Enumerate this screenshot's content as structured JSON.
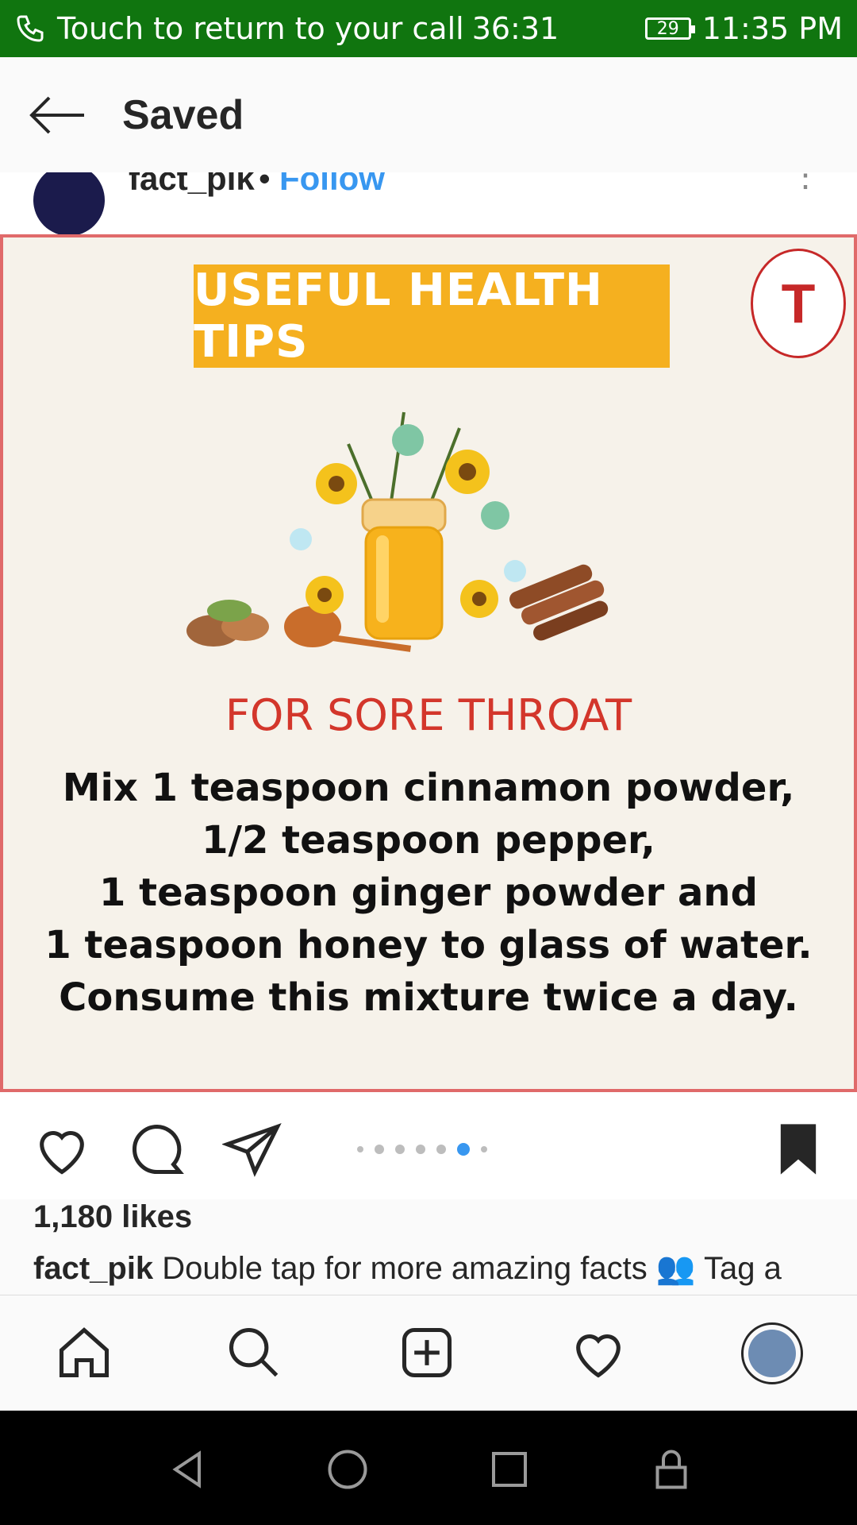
{
  "status_bar": {
    "call_text": "Touch to return to your call",
    "call_timer": "36:31",
    "battery": "29",
    "time": "11:35 PM"
  },
  "header": {
    "title": "Saved",
    "back_icon": "arrow-left-icon"
  },
  "post": {
    "username": "fact_pik",
    "separator": "•",
    "follow_label": "Follow",
    "more_icon": "more-vertical-icon",
    "image": {
      "banner": "USEFUL HEALTH TIPS",
      "logo_letter": "T",
      "subtitle": "FOR SORE THROAT",
      "lines": [
        "Mix 1 teaspoon cinnamon powder,",
        "1/2 teaspoon pepper,",
        "1 teaspoon ginger powder and",
        "1 teaspoon honey to glass of water.",
        "Consume this mixture twice a day."
      ]
    },
    "carousel": {
      "count": 7,
      "active_index": 5
    },
    "likes": "1,180 likes",
    "caption_user": "fact_pik",
    "caption_text": "Double tap for more amazing facts",
    "caption_tail": "Tag a"
  },
  "bottom_nav": [
    "home-icon",
    "search-icon",
    "add-icon",
    "heart-icon",
    "profile-avatar"
  ],
  "system_nav": [
    "back-triangle-icon",
    "home-circle-icon",
    "recents-square-icon",
    "lock-icon"
  ],
  "colors": {
    "status_bar": "#10750f",
    "follow": "#3897f0",
    "accent_red": "#d3362b",
    "banner": "#f8b924"
  }
}
